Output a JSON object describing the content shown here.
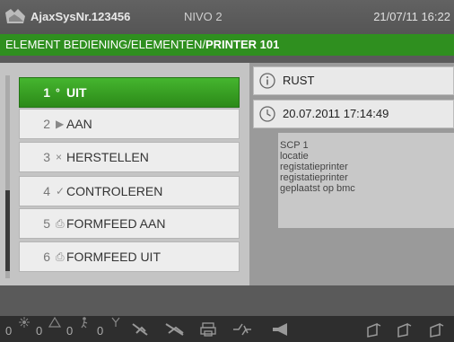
{
  "header": {
    "system_name": "AjaxSysNr.123456",
    "level": "NIVO 2",
    "datetime": "21/07/11 16:22"
  },
  "breadcrumb": {
    "path": "ELEMENT BEDIENING/ELEMENTEN/",
    "current": "PRINTER 101"
  },
  "menu": {
    "items": [
      {
        "num": "1",
        "symbol": "°",
        "label": "UIT",
        "active": true
      },
      {
        "num": "2",
        "symbol": "▶",
        "label": "AAN",
        "active": false
      },
      {
        "num": "3",
        "symbol": "×",
        "label": "HERSTELLEN",
        "active": false
      },
      {
        "num": "4",
        "symbol": "✓",
        "label": "CONTROLEREN",
        "active": false
      },
      {
        "num": "5",
        "symbol": "⎙",
        "label": "FORMFEED AAN",
        "active": false
      },
      {
        "num": "6",
        "symbol": "⎙",
        "label": "FORMFEED UIT",
        "active": false
      }
    ]
  },
  "info": {
    "state": "RUST",
    "state_icon": "info-icon",
    "timestamp": "20.07.2011 17:14:49",
    "timestamp_icon": "clock-icon"
  },
  "description": {
    "lines": [
      "SCP 1",
      "locatie",
      "registatieprinter",
      "registatieprinter",
      "geplaatst op bmc"
    ]
  },
  "statusbar": {
    "counters": [
      {
        "value": "0",
        "icon": "fire-alarm-icon"
      },
      {
        "value": "0",
        "icon": "warning-triangle-icon"
      },
      {
        "value": "0",
        "icon": "person-alarm-icon"
      },
      {
        "value": "0",
        "icon": "fault-icon"
      }
    ],
    "icons": [
      "disabled-detector-icon",
      "disabled-zone-icon",
      "printer-icon",
      "bypass-icon",
      "horn-icon",
      "door-icon",
      "door-icon-2",
      "door-icon-3"
    ]
  },
  "colors": {
    "accent_green": "#2f8f1f",
    "active_item_green": "#3aa826"
  }
}
